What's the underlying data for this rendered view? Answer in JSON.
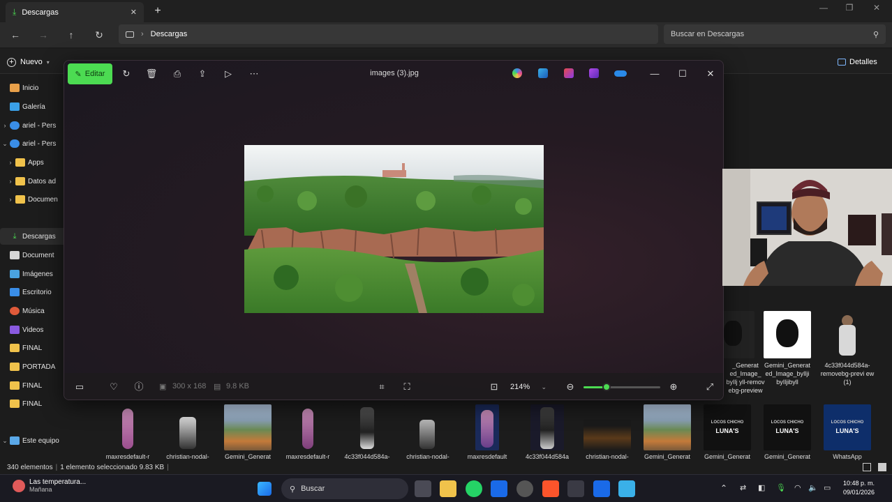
{
  "explorer": {
    "tab_label": "Descargas",
    "address": "Descargas",
    "search_placeholder": "Buscar en Descargas",
    "new_label": "Nuevo",
    "details_label": "Detalles"
  },
  "sidebar": {
    "items": [
      {
        "label": "Inicio"
      },
      {
        "label": "Galería"
      },
      {
        "label": "ariel - Pers"
      },
      {
        "label": "ariel - Pers"
      },
      {
        "label": "Apps"
      },
      {
        "label": "Datos ad"
      },
      {
        "label": "Documen"
      },
      {
        "label": "Descargas"
      },
      {
        "label": "Document"
      },
      {
        "label": "Imágenes"
      },
      {
        "label": "Escritorio"
      },
      {
        "label": "Música"
      },
      {
        "label": "Videos"
      },
      {
        "label": "FINAL"
      },
      {
        "label": "PORTADA"
      },
      {
        "label": "FINAL"
      },
      {
        "label": "FINAL"
      },
      {
        "label": "Este equipo"
      }
    ]
  },
  "viewer": {
    "edit_label": "Editar",
    "title": "images (3).jpg",
    "dimensions": "300 x 168",
    "filesize": "9.8 KB",
    "zoom": "214%",
    "zoom_fraction": 0.3
  },
  "right_tiles": [
    {
      "caption": "_Generat ed_Image_ byIlj yll-remov ebg-preview"
    },
    {
      "caption": "Gemini_Generat ed_Image_byIlji byIljibyll"
    },
    {
      "caption": "4c33f044d584a- removebg-previ ew (1)"
    }
  ],
  "strip": [
    {
      "caption": "maxresdefault-r"
    },
    {
      "caption": "christian-nodal-"
    },
    {
      "caption": "Gemini_Generat"
    },
    {
      "caption": "maxresdefault-r"
    },
    {
      "caption": "4c33f044d584a-"
    },
    {
      "caption": "christian-nodal-"
    },
    {
      "caption": "maxresdefault"
    },
    {
      "caption": "4c33f044d584a"
    },
    {
      "caption": "christian-nodal-"
    },
    {
      "caption": "Gemini_Generat"
    },
    {
      "caption": "Gemini_Generat"
    },
    {
      "caption": "Gemini_Generat"
    },
    {
      "caption": "WhatsApp"
    }
  ],
  "strip_badges": {
    "luna": "LUNA'S",
    "chicho": "LOCOS CHICHO"
  },
  "status": {
    "count": "340 elementos",
    "selection": "1 elemento seleccionado  9.83 KB"
  },
  "taskbar": {
    "weather_title": "Las temperatura...",
    "weather_sub": "Mañana",
    "search_label": "Buscar",
    "time": "10:48 p. m.",
    "date": "09/01/2026"
  },
  "colors": {
    "accent": "#4cdb52",
    "folder": "#f0c24b"
  }
}
